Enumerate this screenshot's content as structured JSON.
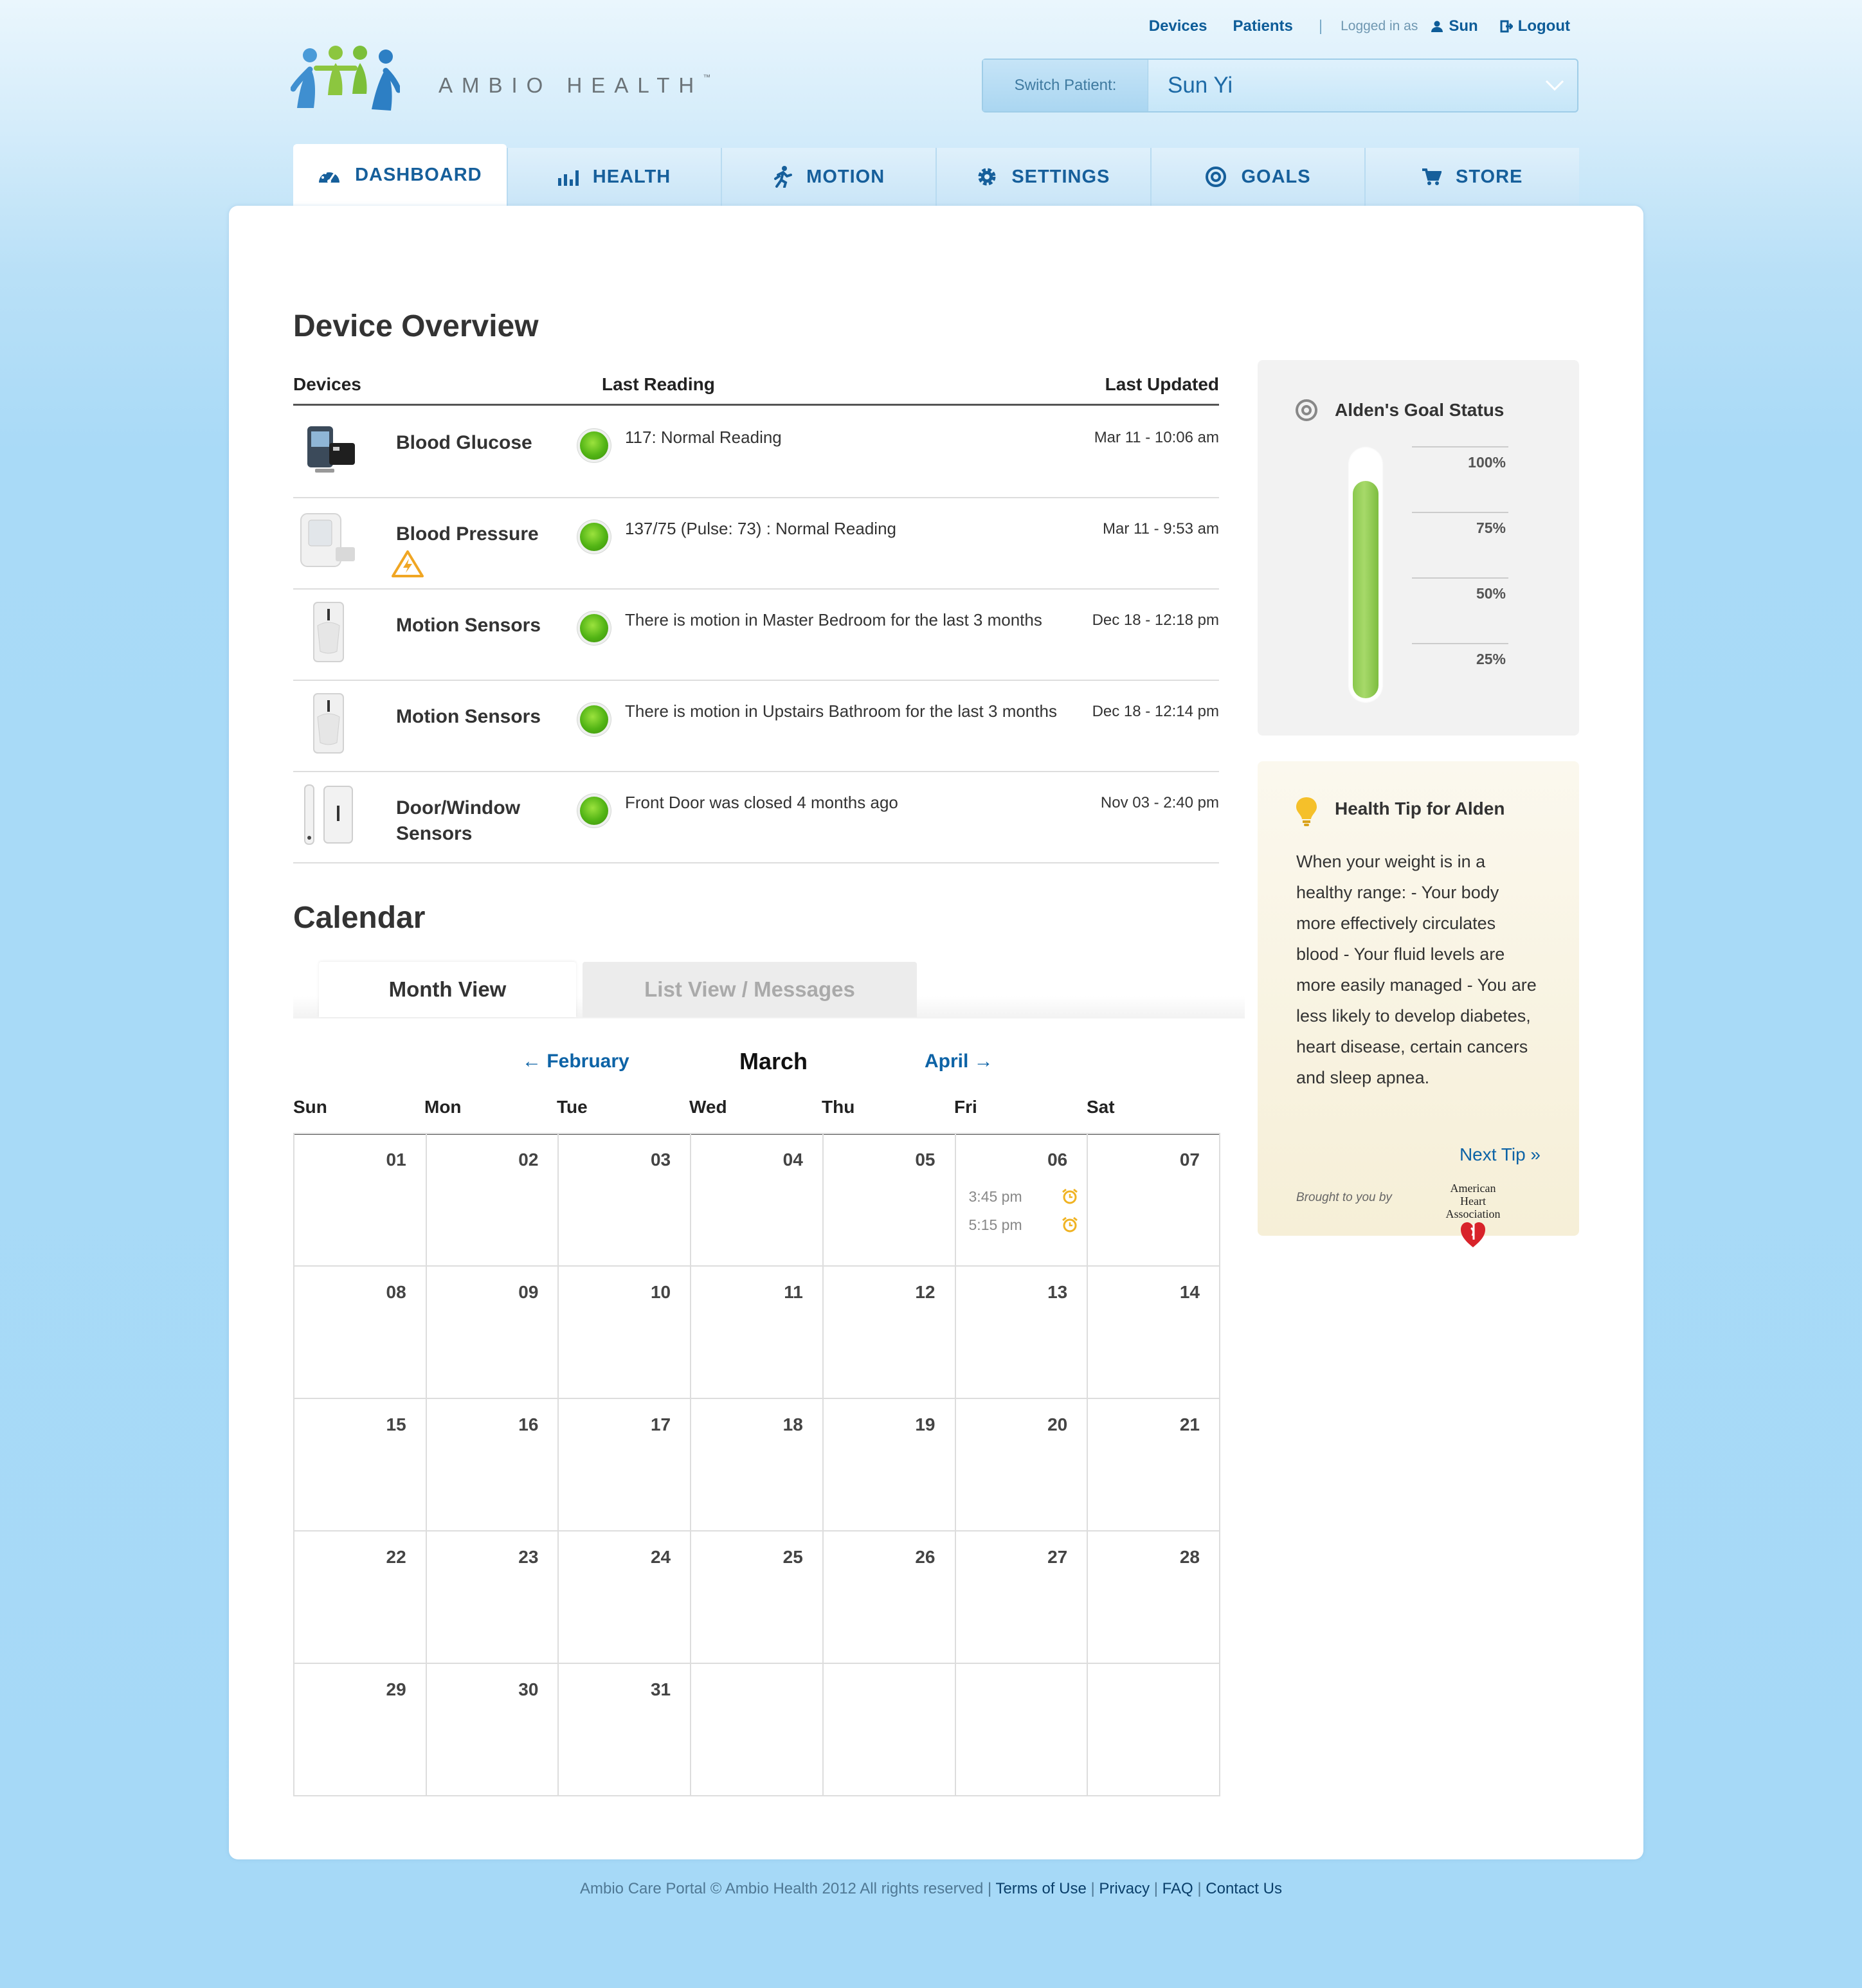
{
  "top_links": {
    "devices": "Devices",
    "patients": "Patients",
    "separator": "|",
    "logged_in_as": "Logged in as",
    "user": "Sun",
    "logout": "Logout"
  },
  "logo": {
    "text": "AMBIO HEALTH",
    "tm": "™"
  },
  "switch_patient": {
    "label": "Switch Patient:",
    "value": "Sun Yi"
  },
  "nav": [
    {
      "label": "DASHBOARD",
      "icon": "speedometer-icon",
      "active": true
    },
    {
      "label": "HEALTH",
      "icon": "bar-chart-icon"
    },
    {
      "label": "MOTION",
      "icon": "runner-icon"
    },
    {
      "label": "SETTINGS",
      "icon": "gear-icon"
    },
    {
      "label": "GOALS",
      "icon": "target-icon"
    },
    {
      "label": "STORE",
      "icon": "cart-icon"
    }
  ],
  "device_overview": {
    "title": "Device Overview",
    "columns": [
      "Devices",
      "Last Reading",
      "Last Updated"
    ],
    "rows": [
      {
        "name": "Blood Glucose",
        "reading": "117: Normal Reading",
        "updated": "Mar 11 - 10:06 am",
        "status": "green"
      },
      {
        "name": "Blood Pressure",
        "reading": "137/75 (Pulse: 73) : Normal Reading",
        "updated": "Mar 11 - 9:53 am",
        "status": "green",
        "warning": "battery-warning-icon"
      },
      {
        "name": "Motion Sensors",
        "reading": "There is motion in Master Bedroom for the last 3 months",
        "updated": "Dec 18 - 12:18 pm",
        "status": "green"
      },
      {
        "name": "Motion Sensors",
        "reading": "There is motion in Upstairs Bathroom for the last 3 months",
        "updated": "Dec 18 - 12:14 pm",
        "status": "green"
      },
      {
        "name": "Door/Window Sensors",
        "reading": "Front Door was closed 4 months ago",
        "updated": "Nov 03 - 2:40 pm",
        "status": "green"
      }
    ]
  },
  "calendar": {
    "title": "Calendar",
    "tabs": [
      "Month View",
      "List View / Messages"
    ],
    "prev": "← February",
    "month": "March",
    "next": "April →",
    "weekdays": [
      "Sun",
      "Mon",
      "Tue",
      "Wed",
      "Thu",
      "Fri",
      "Sat"
    ],
    "weeks": [
      [
        "01",
        "02",
        "03",
        "04",
        "05",
        "06",
        "07"
      ],
      [
        "08",
        "09",
        "10",
        "11",
        "12",
        "13",
        "14"
      ],
      [
        "15",
        "16",
        "17",
        "18",
        "19",
        "20",
        "21"
      ],
      [
        "22",
        "23",
        "24",
        "25",
        "26",
        "27",
        "28"
      ],
      [
        "29",
        "30",
        "31",
        "",
        "",
        "",
        ""
      ]
    ],
    "events": [
      {
        "day": "06",
        "time": "3:45 pm",
        "icon": "alarm-clock-icon"
      },
      {
        "day": "06",
        "time": "5:15 pm",
        "icon": "alarm-clock-icon"
      }
    ]
  },
  "goal_status": {
    "title": "Alden's Goal Status",
    "ticks": [
      "100%",
      "75%",
      "50%",
      "25%"
    ],
    "progress": 0.88,
    "color": "#8bc94e"
  },
  "health_tip": {
    "title": "Health Tip for Alden",
    "body": "When your weight is in a healthy range: - Your body more effectively circulates blood - Your fluid levels are more easily managed - You are less likely to develop diabetes, heart disease, certain cancers and sleep apnea.",
    "next": "Next Tip »",
    "brought": "Brought to you by",
    "sponsor": "American Heart Association"
  },
  "footer": {
    "text": "Ambio Care Portal © Ambio Health 2012 All rights reserved |",
    "links": [
      "Terms of Use",
      "Privacy",
      "FAQ",
      "Contact Us"
    ]
  },
  "colors": {
    "accent": "#0d63a6",
    "status_green": "#52b415",
    "background": "#a6d9f7"
  }
}
